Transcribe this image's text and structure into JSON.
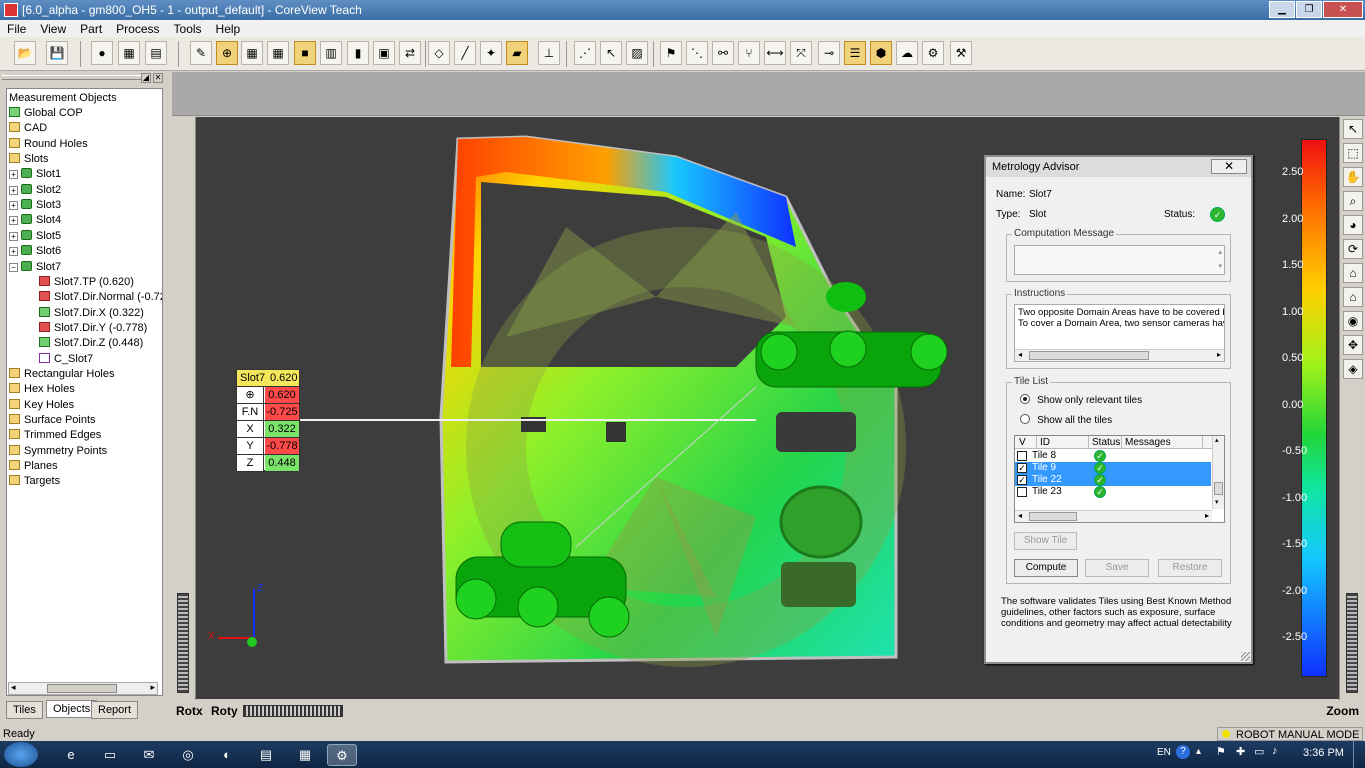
{
  "window": {
    "title": "[6.0_alpha - gm800_OH5 - 1 - output_default] - CoreView Teach"
  },
  "menu": [
    "File",
    "View",
    "Part",
    "Process",
    "Tools",
    "Help"
  ],
  "tree": {
    "root": "Measurement Objects",
    "items": [
      {
        "label": "Global COP",
        "level": 0,
        "icon": "cop"
      },
      {
        "label": "CAD",
        "level": 0,
        "icon": "folder"
      },
      {
        "label": "Round Holes",
        "level": 0,
        "icon": "folder"
      },
      {
        "label": "Slots",
        "level": 0,
        "icon": "folder"
      },
      {
        "label": "Slot1",
        "level": 1,
        "icon": "slot",
        "expand": "+"
      },
      {
        "label": "Slot2",
        "level": 1,
        "icon": "slot",
        "expand": "+"
      },
      {
        "label": "Slot3",
        "level": 1,
        "icon": "slot",
        "expand": "+"
      },
      {
        "label": "Slot4",
        "level": 1,
        "icon": "slot",
        "expand": "+"
      },
      {
        "label": "Slot5",
        "level": 1,
        "icon": "slot",
        "expand": "+"
      },
      {
        "label": "Slot6",
        "level": 1,
        "icon": "slot",
        "expand": "+"
      },
      {
        "label": "Slot7",
        "level": 1,
        "icon": "slot",
        "expand": "−"
      },
      {
        "label": "Slot7.TP  (0.620)",
        "level": 2,
        "icon": "red"
      },
      {
        "label": "Slot7.Dir.Normal  (-0.72",
        "level": 2,
        "icon": "red"
      },
      {
        "label": "Slot7.Dir.X  (0.322)",
        "level": 2,
        "icon": "grn"
      },
      {
        "label": "Slot7.Dir.Y  (-0.778)",
        "level": 2,
        "icon": "red"
      },
      {
        "label": "Slot7.Dir.Z  (0.448)",
        "level": 2,
        "icon": "grn"
      },
      {
        "label": "C_Slot7",
        "level": 2,
        "icon": "purple"
      },
      {
        "label": "Rectangular Holes",
        "level": 0,
        "icon": "folder"
      },
      {
        "label": "Hex Holes",
        "level": 0,
        "icon": "folder"
      },
      {
        "label": "Key Holes",
        "level": 0,
        "icon": "folder"
      },
      {
        "label": "Surface Points",
        "level": 0,
        "icon": "folder"
      },
      {
        "label": "Trimmed Edges",
        "level": 0,
        "icon": "folder"
      },
      {
        "label": "Symmetry Points",
        "level": 0,
        "icon": "folder"
      },
      {
        "label": "Planes",
        "level": 0,
        "icon": "folder"
      },
      {
        "label": "Targets",
        "level": 0,
        "icon": "folder"
      }
    ]
  },
  "panel_tabs": [
    "Tiles",
    "Objects",
    "Report"
  ],
  "measurement": {
    "title": "Slot7",
    "value": "0.620",
    "rows": [
      {
        "key": "⊕",
        "value": "0.620",
        "status": "red"
      },
      {
        "key": "F.N",
        "value": "-0.725",
        "status": "red"
      },
      {
        "key": "X",
        "value": "0.322",
        "status": "green"
      },
      {
        "key": "Y",
        "value": "-0.778",
        "status": "red"
      },
      {
        "key": "Z",
        "value": "0.448",
        "status": "green"
      }
    ]
  },
  "legend": {
    "ticks": [
      "2.50",
      "2.00",
      "1.50",
      "1.00",
      "0.50",
      "0.00",
      "-0.50",
      "-1.00",
      "-1.50",
      "-2.00",
      "-2.50"
    ]
  },
  "axes": {
    "z": "Z",
    "x": "X"
  },
  "bottom": {
    "rotx": "Rotx",
    "roty": "Roty",
    "zoom": "Zoom"
  },
  "advisor": {
    "title": "Metrology Advisor",
    "name_label": "Name:",
    "name_value": "Slot7",
    "type_label": "Type:",
    "type_value": "Slot",
    "status_label": "Status:",
    "computation_label": "Computation Message",
    "instructions_label": "Instructions",
    "instructions": [
      "Two opposite Domain Areas have to be covered by",
      "To cover a Domain Area, two sensor cameras have"
    ],
    "tilelist_label": "Tile List",
    "radio_relevant": "Show only relevant tiles",
    "radio_all": "Show all the tiles",
    "columns": [
      "V",
      "ID",
      "Status",
      "Messages"
    ],
    "tiles": [
      {
        "id": "Tile 8",
        "checked": false,
        "selected": false
      },
      {
        "id": "Tile 9",
        "checked": true,
        "selected": true
      },
      {
        "id": "Tile 22",
        "checked": true,
        "selected": true
      },
      {
        "id": "Tile 23",
        "checked": false,
        "selected": false
      }
    ],
    "show_tile": "Show Tile",
    "compute": "Compute",
    "save": "Save",
    "restore": "Restore",
    "footer": [
      "The software validates Tiles using Best Known Method",
      "guidelines, other factors such as exposure, surface",
      "conditions and geometry may affect actual detectability"
    ]
  },
  "status": {
    "left": "Ready",
    "mode": "ROBOT MANUAL MODE"
  },
  "taskbar": {
    "lang": "EN",
    "time": "3:36 PM"
  }
}
